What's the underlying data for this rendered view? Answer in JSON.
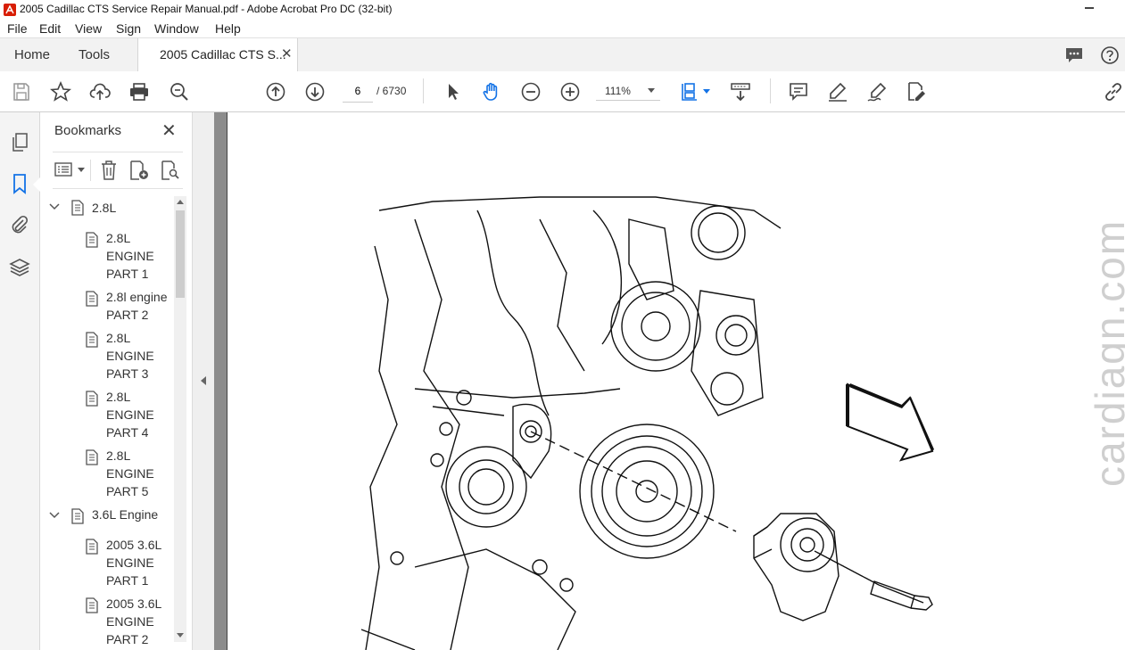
{
  "window": {
    "title": "2005 Cadillac CTS Service Repair Manual.pdf - Adobe Acrobat Pro DC (32-bit)"
  },
  "menu": [
    "File",
    "Edit",
    "View",
    "Sign",
    "Window",
    "Help"
  ],
  "tabs": {
    "home": "Home",
    "tools": "Tools",
    "document": "2005 Cadillac CTS S..."
  },
  "toolbar": {
    "page_current": "6",
    "page_total": "/ 6730",
    "zoom": "111%"
  },
  "bookmarks": {
    "title": "Bookmarks",
    "items": [
      {
        "label": "2.8L",
        "level": 0,
        "expanded": true
      },
      {
        "label": "2.8L ENGINE PART 1",
        "level": 1
      },
      {
        "label": "2.8l engine PART 2",
        "level": 1
      },
      {
        "label": "2.8L ENGINE PART 3",
        "level": 1
      },
      {
        "label": "2.8L ENGINE PART 4",
        "level": 1
      },
      {
        "label": "2.8L ENGINE PART 5",
        "level": 1
      },
      {
        "label": "3.6L Engine",
        "level": 0,
        "expanded": true
      },
      {
        "label": "2005 3.6L ENGINE PART 1",
        "level": 1
      },
      {
        "label": "2005 3.6L ENGINE PART 2",
        "level": 1
      }
    ]
  },
  "document": {
    "watermark": "cardiagn.com"
  },
  "colors": {
    "acrobat_red": "#d81e05",
    "link_blue": "#1473e6",
    "rail_bg": "#f4f4f4",
    "gutter": "#8c8c8c"
  }
}
